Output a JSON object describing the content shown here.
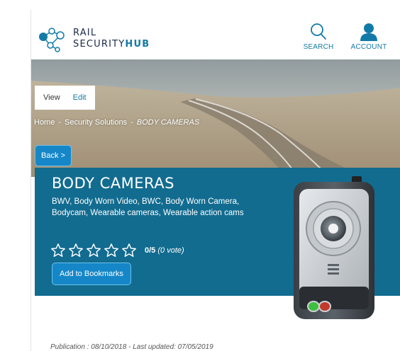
{
  "header": {
    "logo_line1": "RAIL",
    "logo_line2_a": "SECURITY",
    "logo_line2_b": "HUB",
    "search_label": "SEARCH",
    "account_label": "ACCOUNT",
    "icons": {
      "search": "search-icon",
      "account": "user-icon"
    }
  },
  "tabs": [
    {
      "label": "View"
    },
    {
      "label": "Edit"
    }
  ],
  "breadcrumb": {
    "home": "Home",
    "section": "Security Solutions",
    "current": "BODY CAMERAS",
    "separator": "-"
  },
  "back_label": "Back >",
  "solution": {
    "title": "BODY CAMERAS",
    "description": "BWV, Body Worn Video, BWC, Body Worn Camera, Bodycam, Wearable cameras, Wearable action cams",
    "rating_score": "0/5",
    "rating_votes": "(0 vote)",
    "stars_filled": 0,
    "stars_total": 5,
    "bookmark_label": "Add to Bookmarks"
  },
  "meta": {
    "publication": "Publication : 08/10/2018  -  Last updated: 07/05/2019"
  },
  "colors": {
    "brand_blue": "#137aa8",
    "band_blue": "#126c90",
    "button_blue": "#1587c8"
  }
}
